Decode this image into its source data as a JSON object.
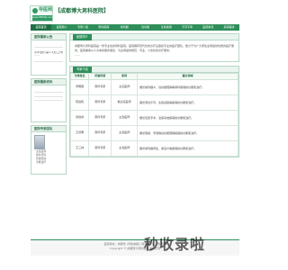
{
  "header": {
    "logo_name": "导医网",
    "logo_sub": "www.HBYS8.com",
    "site_title": "【成都博大男科医院】"
  },
  "nav": {
    "items": [
      "医院首页",
      "医院简介",
      "专家介绍",
      "男科疾病",
      "前列腺",
      "性功能",
      "生殖健康",
      "不育不孕",
      "医院新闻",
      "来院路线"
    ]
  },
  "sidebar": {
    "box1_title": "医院最新公告",
    "box1_lines": [
      "手术治疗(第1-3天)工作日程表",
      "......"
    ],
    "box2_title": "医院最新资讯",
    "box3_title": "医院专家团队",
    "box3_doc_lines": [
      "主任医师",
      "擅长男科",
      "各类疾病",
      "诊断治疗"
    ]
  },
  "main": {
    "intro_tab": "医院简介",
    "intro_text": "成都博大男科医院是一所专业性的男科医院，医院拥有现代化的诊疗设备和专业的医疗团队，致力于为广大男性患者提供优质的医疗服务，医院秉承以人为本的服务理念，为患者提供规范、专业、人性化的诊疗服务。",
    "intro_more": "......",
    "doctors_tab": "专家介绍",
    "table_headers": [
      "专家姓名",
      "所属科室",
      "职称",
      "擅长领域"
    ],
    "doctors": [
      {
        "name": "周明国",
        "dept": "男科专家",
        "title": "主任医师",
        "desc": "擅长前列腺炎、性功能障碍等男科疾病的诊断和治疗。"
      },
      {
        "name": "陈建民",
        "dept": "男科专家",
        "title": "副主任医师",
        "desc": "擅长男性不育、生殖感染等疾病的诊断和治疗。"
      },
      {
        "name": "张建成",
        "dept": "男科专家",
        "title": "主治医师",
        "desc": "擅长包皮手术、泌尿系统疾病的诊断和治疗。"
      },
      {
        "name": "王德明",
        "dept": "男科专家",
        "title": "主治医师",
        "desc": "擅长阳痿、早泄等性功能障碍疾病的诊断和治疗。"
      },
      {
        "name": "王三林",
        "dept": "男科专家",
        "title": "主治医师",
        "desc": "擅长前列腺增生、尿道炎等疾病的诊断和治疗。"
      }
    ]
  },
  "footer": {
    "line1": "医院地址：成都市 | 网站地图 | 联系我们 | 免责声明",
    "line2": "Copyright © 成都博大男科医院 版权所有"
  },
  "watermark": "秒收录啦"
}
